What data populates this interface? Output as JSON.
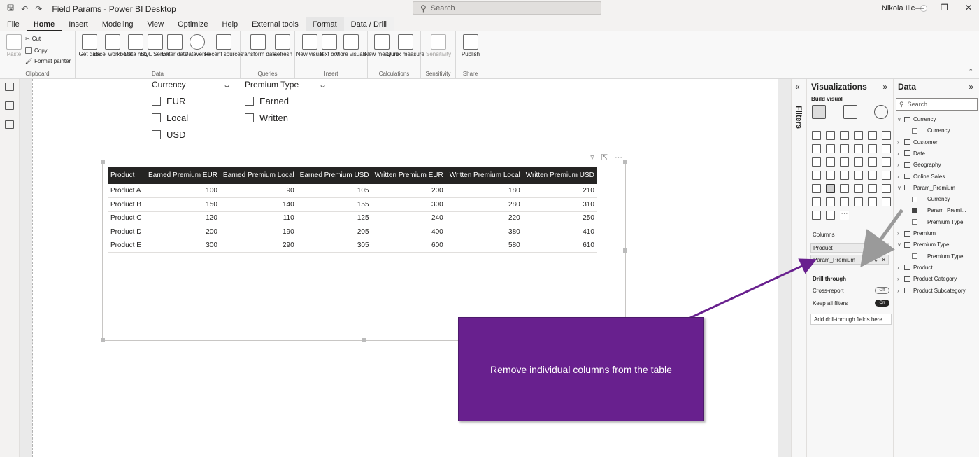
{
  "titlebar": {
    "title": "Field Params - Power BI Desktop",
    "search_placeholder": "Search",
    "user": "Nikola Ilic"
  },
  "menu_tabs": [
    "File",
    "Home",
    "Insert",
    "Modeling",
    "View",
    "Optimize",
    "Help",
    "External tools",
    "Format",
    "Data / Drill"
  ],
  "ribbon": {
    "clipboard": {
      "label": "Clipboard",
      "paste": "Paste",
      "cut": "Cut",
      "copy": "Copy",
      "format_painter": "Format painter"
    },
    "data": {
      "label": "Data",
      "buttons": [
        "Get data",
        "Excel workbook",
        "Data hub",
        "SQL Server",
        "Enter data",
        "Dataverse",
        "Recent sources"
      ]
    },
    "queries": {
      "label": "Queries",
      "buttons": [
        "Transform data",
        "Refresh"
      ]
    },
    "insert": {
      "label": "Insert",
      "buttons": [
        "New visual",
        "Text box",
        "More visuals"
      ]
    },
    "calculations": {
      "label": "Calculations",
      "buttons": [
        "New measure",
        "Quick measure"
      ]
    },
    "sensitivity": {
      "label": "Sensitivity",
      "buttons": [
        "Sensitivity"
      ]
    },
    "share": {
      "label": "Share",
      "buttons": [
        "Publish"
      ]
    }
  },
  "slicers": {
    "currency": {
      "title": "Currency",
      "items": [
        "EUR",
        "Local",
        "USD"
      ]
    },
    "premium_type": {
      "title": "Premium Type",
      "items": [
        "Earned",
        "Written"
      ]
    }
  },
  "table": {
    "headers": [
      "Product",
      "Earned Premium EUR",
      "Earned Premium Local",
      "Earned Premium USD",
      "Written Premium EUR",
      "Written Premium Local",
      "Written Premium USD"
    ],
    "rows": [
      [
        "Product A",
        "100",
        "90",
        "105",
        "200",
        "180",
        "210"
      ],
      [
        "Product B",
        "150",
        "140",
        "155",
        "300",
        "280",
        "310"
      ],
      [
        "Product C",
        "120",
        "110",
        "125",
        "240",
        "220",
        "250"
      ],
      [
        "Product D",
        "200",
        "190",
        "205",
        "400",
        "380",
        "410"
      ],
      [
        "Product E",
        "300",
        "290",
        "305",
        "600",
        "580",
        "610"
      ]
    ]
  },
  "callout": {
    "text": "Remove individual columns from the table",
    "color": "#68208e"
  },
  "filters_label": "Filters",
  "visualizations": {
    "title": "Visualizations",
    "build_visual": "Build visual",
    "columns_label": "Columns",
    "wells": [
      "Product",
      "Param_Premium"
    ],
    "drill_through": "Drill through",
    "cross_report": "Cross-report",
    "cross_report_state": "Off",
    "keep_all_filters": "Keep all filters",
    "keep_all_filters_state": "On",
    "add_drill": "Add drill-through fields here"
  },
  "data_pane": {
    "title": "Data",
    "search_placeholder": "Search",
    "tree": [
      {
        "label": "Currency",
        "level": 0,
        "type": "table",
        "expanded": true
      },
      {
        "label": "Currency",
        "level": 1,
        "type": "field",
        "checked": false
      },
      {
        "label": "Customer",
        "level": 0,
        "type": "table",
        "expanded": false
      },
      {
        "label": "Date",
        "level": 0,
        "type": "table",
        "expanded": false
      },
      {
        "label": "Geography",
        "level": 0,
        "type": "table",
        "expanded": false
      },
      {
        "label": "Online Sales",
        "level": 0,
        "type": "table",
        "expanded": false
      },
      {
        "label": "Param_Premium",
        "level": 0,
        "type": "table",
        "expanded": true
      },
      {
        "label": "Currency",
        "level": 1,
        "type": "field",
        "checked": false
      },
      {
        "label": "Param_Premi...",
        "level": 1,
        "type": "field",
        "checked": true
      },
      {
        "label": "Premium Type",
        "level": 1,
        "type": "field",
        "checked": false
      },
      {
        "label": "Premium",
        "level": 0,
        "type": "table",
        "expanded": false
      },
      {
        "label": "Premium Type",
        "level": 0,
        "type": "table",
        "expanded": true
      },
      {
        "label": "Premium Type",
        "level": 1,
        "type": "field",
        "checked": false
      },
      {
        "label": "Product",
        "level": 0,
        "type": "table",
        "expanded": false
      },
      {
        "label": "Product Category",
        "level": 0,
        "type": "table",
        "expanded": false
      },
      {
        "label": "Product Subcategory",
        "level": 0,
        "type": "table",
        "expanded": false
      }
    ]
  }
}
